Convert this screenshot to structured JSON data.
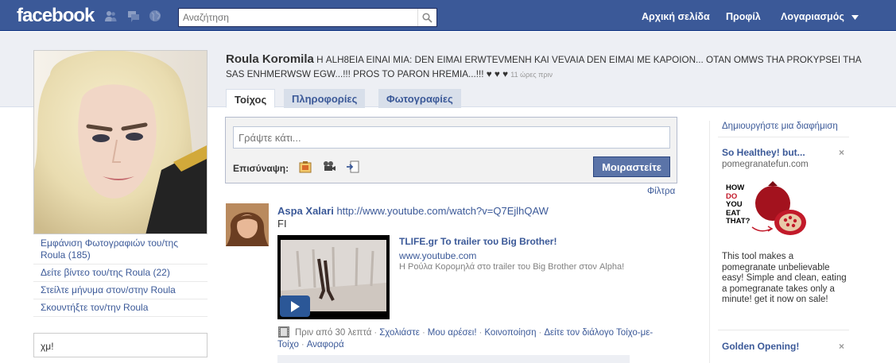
{
  "topbar": {
    "logo": "facebook",
    "search_placeholder": "Αναζήτηση",
    "nav": [
      "Αρχική σελίδα",
      "Προφίλ",
      "Λογαριασμός"
    ]
  },
  "profile": {
    "name": "Roula Koromila",
    "status": "Η ALH8EIA EINAI MIA: DEN EIMAI ERWTEVMENH KAI VEVAIA DEN EIMAI ME KAPOION... OTAN OMWS THA PROKYPSEI THA SAS ENHMERWSW EGW...!!! PROS TO PARON HREMIA...!!! ♥ ♥ ♥",
    "status_time": "11 ώρες πριν",
    "left_links": [
      "Εμφάνιση Φωτογραφιών του/της Roula (185)",
      "Δείτε βίντεο του/της Roula (22)",
      "Στείλτε μήνυμα στον/στην Roula",
      "Σκουντήξτε τον/την Roula"
    ],
    "mini_status": "χμ!"
  },
  "tabs": [
    "Τοίχος",
    "Πληροφορίες",
    "Φωτογραφίες"
  ],
  "composer": {
    "placeholder": "Γράψτε κάτι...",
    "attach_label": "Επισύναψη:",
    "share_label": "Μοιραστείτε",
    "filter_label": "Φίλτρα"
  },
  "story": {
    "author": "Aspa Xalari",
    "url": "http://www.youtube.com/watch?v=Q7EjlhQAW",
    "url_tail": "FI",
    "video_title": "TLIFE.gr Το trailer του Big Brother!",
    "video_domain": "www.youtube.com",
    "video_desc": "Η Ρούλα Κορομηλά στο trailer του Big Brother στον Alpha!",
    "time": "Πριν από 30 λεπτά",
    "actions": [
      "Σχολιάστε",
      "Μου αρέσει!",
      "Κοινοποίηση",
      "Δείτε τον διάλογο Τοίχο-με-Τοίχο",
      "Αναφορά"
    ]
  },
  "ads": {
    "create_label": "Δημιουργήστε μια διαφήμιση",
    "ad1": {
      "title": "So Healthey! but...",
      "domain": "pomegranatefun.com",
      "image_text": [
        "HOW",
        "DO",
        "YOU",
        "EAT",
        "THAT?"
      ],
      "body": "This tool makes a pomegranate unbelievable easy! Simple and clean, eating a pomegranate takes only a minute! get it now on sale!"
    },
    "ad2": {
      "title": "Golden Opening!"
    },
    "close_symbol": "×"
  },
  "colors": {
    "brand": "#3b5998",
    "header_band": "#edeff4",
    "share_button": "#5b74a8"
  }
}
